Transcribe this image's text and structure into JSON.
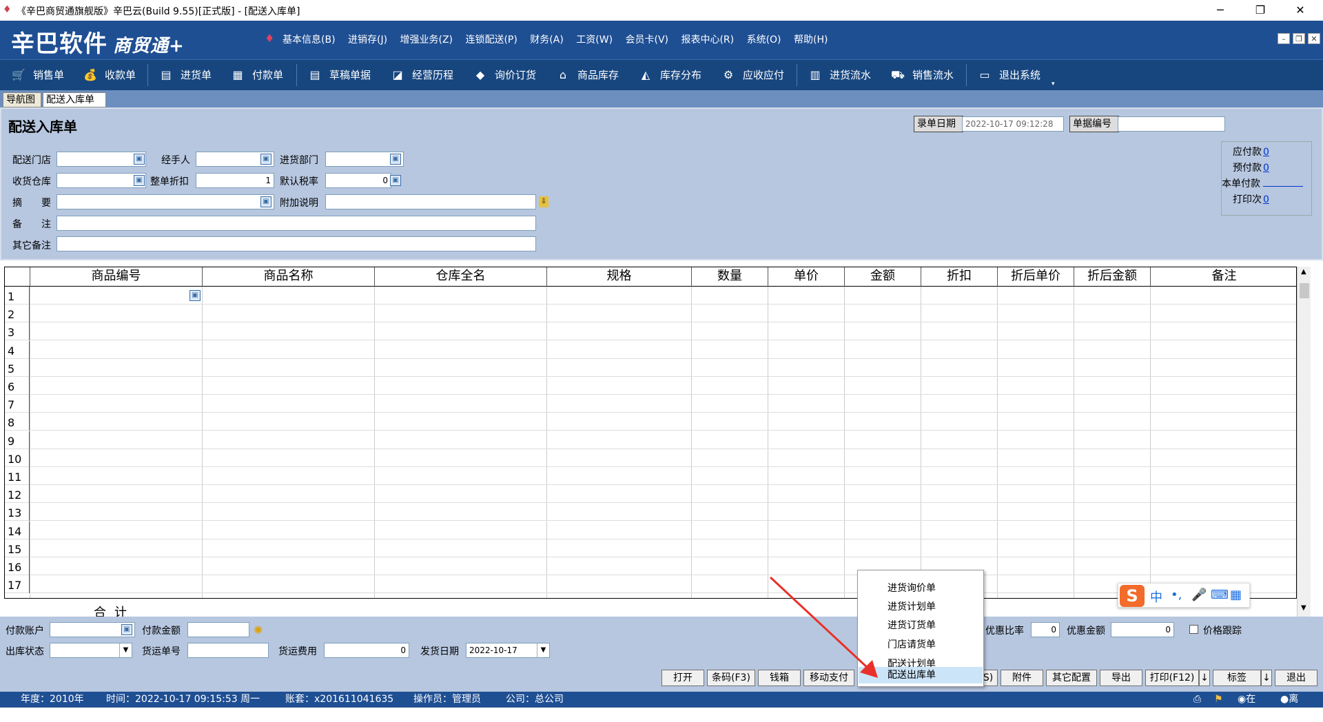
{
  "window": {
    "title": "《辛巴商贸通旗舰版》辛巴云(Build 9.55)[正式版] - [配送入库单]"
  },
  "logo": {
    "main": "辛巴软件",
    "sub": "商贸通+"
  },
  "menu": [
    "基本信息(B)",
    "进销存(J)",
    "增强业务(Z)",
    "连锁配送(P)",
    "财务(A)",
    "工资(W)",
    "会员卡(V)",
    "报表中心(R)",
    "系统(O)",
    "帮助(H)"
  ],
  "toolbar": [
    "销售单",
    "收款单",
    "进货单",
    "付款单",
    "草稿单据",
    "经营历程",
    "询价订货",
    "商品库存",
    "库存分布",
    "应收应付",
    "进货流水",
    "销售流水",
    "退出系统"
  ],
  "tabs": [
    "导航图",
    "配送入库单"
  ],
  "form": {
    "title": "配送入库单",
    "date_label": "录单日期",
    "date_value": "2022-10-17 09:12:28",
    "docno_label": "单据编号",
    "docno_value": "",
    "labels": {
      "store": "配送门店",
      "handler": "经手人",
      "dept": "进货部门",
      "warehouse": "收货仓库",
      "discount": "整单折扣",
      "taxrate": "默认税率",
      "summary": "摘　　要",
      "extra": "附加说明",
      "remark": "备　　注",
      "other_remark": "其它备注"
    },
    "values": {
      "discount": "1",
      "taxrate": "0"
    }
  },
  "summary_box": {
    "payable_label": "应付款",
    "payable": "0",
    "prepaid_label": "预付款",
    "prepaid": "0",
    "thispay_label": "本单付款",
    "prints_label": "打印次",
    "prints": "0"
  },
  "grid": {
    "columns": [
      "商品编号",
      "商品名称",
      "仓库全名",
      "规格",
      "数量",
      "单价",
      "金额",
      "折扣",
      "折后单价",
      "折后金额",
      "备注"
    ],
    "rows": [
      "1",
      "2",
      "3",
      "4",
      "5",
      "6",
      "7",
      "8",
      "9",
      "10",
      "11",
      "12",
      "13",
      "14",
      "15",
      "16",
      "17"
    ],
    "total_label": "合计"
  },
  "bottom": {
    "pay_account": "付款账户",
    "pay_amount": "付款金额",
    "out_status": "出库状态",
    "ship_no": "货运单号",
    "ship_fee": "货运费用",
    "ship_fee_value": "0",
    "ship_date": "发货日期",
    "ship_date_value": "2022-10-17",
    "discount_rate": "优惠比率",
    "discount_rate_value": "0",
    "discount_amt": "优惠金额",
    "discount_amt_value": "0",
    "price_track": "价格跟踪"
  },
  "buttons": [
    "打开",
    "条码(F3)",
    "钱箱",
    "移动支付",
    "S)",
    "附件",
    "其它配置",
    "导出",
    "打印(F12)",
    "↓",
    "标签",
    "↓",
    "退出"
  ],
  "popup_menu": [
    "进货询价单",
    "进货计划单",
    "进货订货单",
    "门店请货单",
    "配送计划单",
    "配送出库单"
  ],
  "ime": {
    "lang": "中"
  },
  "status": {
    "year": "年度：2010年",
    "time": "时间：2022-10-17 09:15:53 周一",
    "account": "账套：x201611041635",
    "operator": "操作员：管理员",
    "company": "公司：总公司",
    "online": "在线",
    "offline": "离线"
  }
}
